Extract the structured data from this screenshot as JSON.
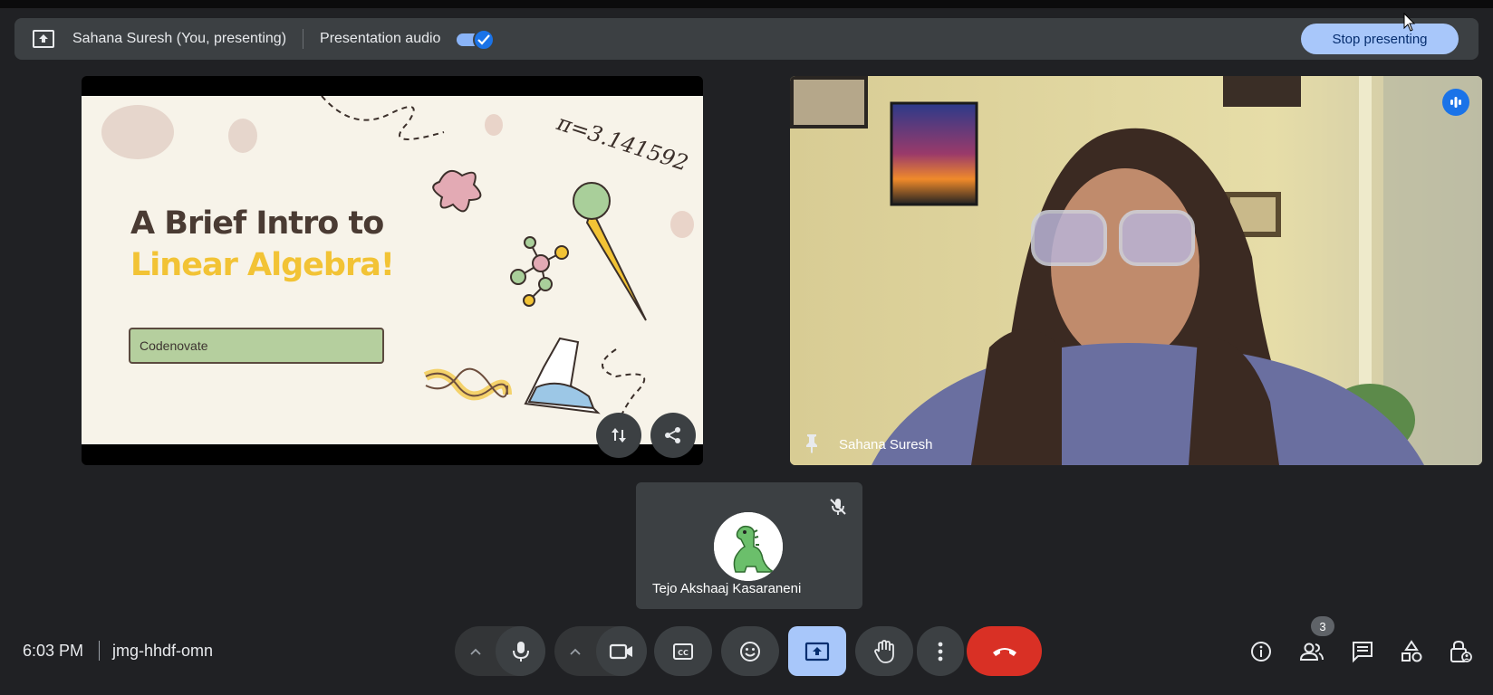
{
  "banner": {
    "presenter": "Sahana Suresh (You, presenting)",
    "audio_label": "Presentation audio",
    "audio_on": true,
    "stop_label": "Stop presenting"
  },
  "slide": {
    "title_line1": "A Brief Intro to",
    "title_line2": "Linear Algebra!",
    "box_text": "Codenovate",
    "pi_text": "π=3.141592"
  },
  "video": {
    "name": "Sahana Suresh"
  },
  "participant": {
    "name": "Tejo Akshaaj Kasaraneni",
    "muted": true
  },
  "footer": {
    "time": "6:03 PM",
    "meeting_code": "jmg-hhdf-omn",
    "people_count": "3"
  },
  "colors": {
    "background": "#202124",
    "accent": "#a8c7fa",
    "end_call": "#d93025",
    "active_present": "#a8c7fa"
  }
}
